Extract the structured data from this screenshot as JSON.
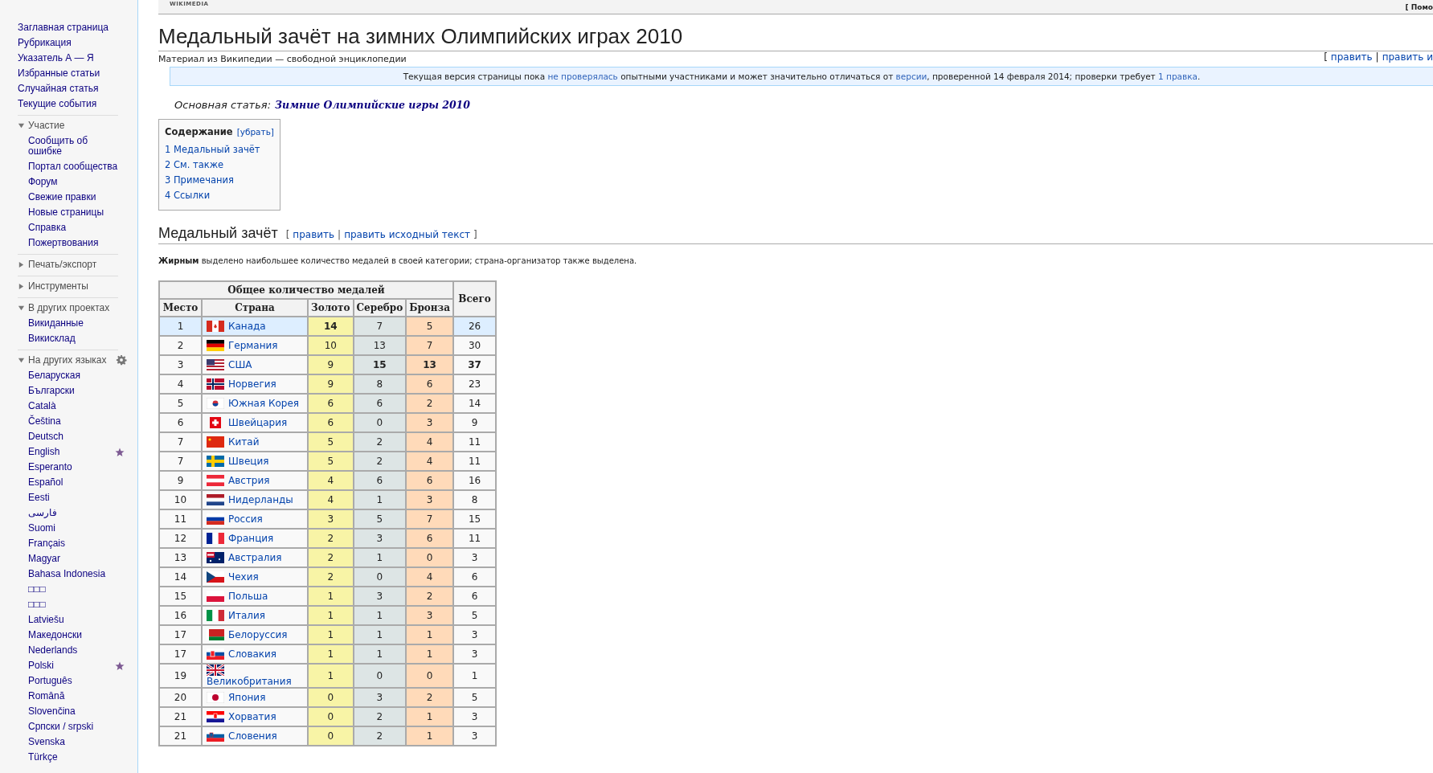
{
  "top_bar": {
    "logo": "WIKIMEDIA",
    "right_text": "[ Помо"
  },
  "sidebar": {
    "links": [
      "Заглавная страница",
      "Рубрикация",
      "Указатель А — Я",
      "Избранные статьи",
      "Случайная статья",
      "Текущие события"
    ],
    "sections": [
      {
        "kind": "links",
        "title": "Участие",
        "expanded": true,
        "items": [
          {
            "label": "Сообщить об ошибке",
            "starred": false
          },
          {
            "label": "Портал сообщества",
            "starred": false
          },
          {
            "label": "Форум",
            "starred": false
          },
          {
            "label": "Свежие правки",
            "starred": false
          },
          {
            "label": "Новые страницы",
            "starred": false
          },
          {
            "label": "Справка",
            "starred": false
          },
          {
            "label": "Пожертвования",
            "starred": false
          }
        ]
      },
      {
        "kind": "links",
        "title": "Печать/экспорт",
        "expanded": false
      },
      {
        "kind": "links",
        "title": "Инструменты",
        "expanded": false
      },
      {
        "kind": "links",
        "title": "В других проектах",
        "expanded": true,
        "items": [
          {
            "label": "Викиданные",
            "starred": false
          },
          {
            "label": "Викисклад",
            "starred": false
          }
        ]
      },
      {
        "kind": "languages",
        "title": "На других языках",
        "expanded": true,
        "items": [
          {
            "label": "Беларуская",
            "starred": false
          },
          {
            "label": "Български",
            "starred": false
          },
          {
            "label": "Català",
            "starred": false
          },
          {
            "label": "Čeština",
            "starred": false
          },
          {
            "label": "Deutsch",
            "starred": false
          },
          {
            "label": "English",
            "starred": true
          },
          {
            "label": "Esperanto",
            "starred": false
          },
          {
            "label": "Español",
            "starred": false
          },
          {
            "label": "Eesti",
            "starred": false
          },
          {
            "label": "فارسی",
            "starred": false
          },
          {
            "label": "Suomi",
            "starred": false
          },
          {
            "label": "Français",
            "starred": false
          },
          {
            "label": "Magyar",
            "starred": false
          },
          {
            "label": "Bahasa Indonesia",
            "starred": false
          },
          {
            "label": "□□□",
            "starred": false
          },
          {
            "label": "□□□",
            "starred": false
          },
          {
            "label": "Latviešu",
            "starred": false
          },
          {
            "label": "Македонски",
            "starred": false
          },
          {
            "label": "Nederlands",
            "starred": false
          },
          {
            "label": "Polski",
            "starred": true
          },
          {
            "label": "Português",
            "starred": false
          },
          {
            "label": "Română",
            "starred": false
          },
          {
            "label": "Slovenčina",
            "starred": false
          },
          {
            "label": "Српски / srpski",
            "starred": false
          },
          {
            "label": "Svenska",
            "starred": false
          },
          {
            "label": "Türkçe",
            "starred": false
          }
        ]
      }
    ]
  },
  "article": {
    "title": "Медальный зачёт на зимних Олимпийских играх 2010",
    "subtitle": "Материал из Википедии — свободной энциклопедии",
    "page_edit": {
      "open": "[",
      "links": [
        "править",
        "править и"
      ],
      "separator": "|"
    },
    "notice": [
      {
        "kind": "text",
        "text": "Текущая версия страницы пока "
      },
      {
        "kind": "link",
        "text": "не проверялась"
      },
      {
        "kind": "text",
        "text": " опытными участниками и может значительно отличаться от "
      },
      {
        "kind": "link",
        "text": "версии"
      },
      {
        "kind": "text",
        "text": ", проверенной 14 февраля 2014; проверки требует "
      },
      {
        "kind": "link",
        "text": "1 правка"
      },
      {
        "kind": "text",
        "text": "."
      }
    ],
    "main_article": {
      "label": "Основная статья:",
      "link": "Зимние Олимпийские игры 2010"
    },
    "toc": {
      "title": "Содержание",
      "toggle": "[убрать]",
      "items": [
        "1 Медальный зачёт",
        "2 См. также",
        "3 Примечания",
        "4 Ссылки"
      ]
    },
    "section": {
      "heading": "Медальный зачёт",
      "edit": {
        "open": "[",
        "links": [
          "править",
          "править исходный текст"
        ],
        "separator": "|",
        "close": "]"
      }
    },
    "legend": "**Жирным** выделено наибольшее количество медалей в своей категории; страна-организатор также выделена.",
    "table": {
      "group_header": "Общее количество медалей",
      "total_header": "Всего",
      "columns": [
        "Место",
        "Страна",
        "Золото",
        "Серебро",
        "Бронза"
      ],
      "rows": [
        {
          "place": "1",
          "country": "Канада",
          "host": true,
          "gold": {
            "value": "14",
            "bold": true
          },
          "silver": {
            "value": "7",
            "bold": false
          },
          "bronze": {
            "value": "5",
            "bold": false
          },
          "total": {
            "value": "26",
            "bold": false
          }
        },
        {
          "place": "2",
          "country": "Германия",
          "host": false,
          "gold": {
            "value": "10",
            "bold": false
          },
          "silver": {
            "value": "13",
            "bold": false
          },
          "bronze": {
            "value": "7",
            "bold": false
          },
          "total": {
            "value": "30",
            "bold": false
          }
        },
        {
          "place": "3",
          "country": "США",
          "host": false,
          "gold": {
            "value": "9",
            "bold": false
          },
          "silver": {
            "value": "15",
            "bold": true
          },
          "bronze": {
            "value": "13",
            "bold": true
          },
          "total": {
            "value": "37",
            "bold": true
          }
        },
        {
          "place": "4",
          "country": "Норвегия",
          "host": false,
          "gold": {
            "value": "9",
            "bold": false
          },
          "silver": {
            "value": "8",
            "bold": false
          },
          "bronze": {
            "value": "6",
            "bold": false
          },
          "total": {
            "value": "23",
            "bold": false
          }
        },
        {
          "place": "5",
          "country": "Южная Корея",
          "host": false,
          "gold": {
            "value": "6",
            "bold": false
          },
          "silver": {
            "value": "6",
            "bold": false
          },
          "bronze": {
            "value": "2",
            "bold": false
          },
          "total": {
            "value": "14",
            "bold": false
          }
        },
        {
          "place": "6",
          "country": "Швейцария",
          "host": false,
          "gold": {
            "value": "6",
            "bold": false
          },
          "silver": {
            "value": "0",
            "bold": false
          },
          "bronze": {
            "value": "3",
            "bold": false
          },
          "total": {
            "value": "9",
            "bold": false
          }
        },
        {
          "place": "7",
          "country": "Китай",
          "host": false,
          "gold": {
            "value": "5",
            "bold": false
          },
          "silver": {
            "value": "2",
            "bold": false
          },
          "bronze": {
            "value": "4",
            "bold": false
          },
          "total": {
            "value": "11",
            "bold": false
          }
        },
        {
          "place": "7",
          "country": "Швеция",
          "host": false,
          "gold": {
            "value": "5",
            "bold": false
          },
          "silver": {
            "value": "2",
            "bold": false
          },
          "bronze": {
            "value": "4",
            "bold": false
          },
          "total": {
            "value": "11",
            "bold": false
          }
        },
        {
          "place": "9",
          "country": "Австрия",
          "host": false,
          "gold": {
            "value": "4",
            "bold": false
          },
          "silver": {
            "value": "6",
            "bold": false
          },
          "bronze": {
            "value": "6",
            "bold": false
          },
          "total": {
            "value": "16",
            "bold": false
          }
        },
        {
          "place": "10",
          "country": "Нидерланды",
          "host": false,
          "gold": {
            "value": "4",
            "bold": false
          },
          "silver": {
            "value": "1",
            "bold": false
          },
          "bronze": {
            "value": "3",
            "bold": false
          },
          "total": {
            "value": "8",
            "bold": false
          }
        },
        {
          "place": "11",
          "country": "Россия",
          "host": false,
          "gold": {
            "value": "3",
            "bold": false
          },
          "silver": {
            "value": "5",
            "bold": false
          },
          "bronze": {
            "value": "7",
            "bold": false
          },
          "total": {
            "value": "15",
            "bold": false
          }
        },
        {
          "place": "12",
          "country": "Франция",
          "host": false,
          "gold": {
            "value": "2",
            "bold": false
          },
          "silver": {
            "value": "3",
            "bold": false
          },
          "bronze": {
            "value": "6",
            "bold": false
          },
          "total": {
            "value": "11",
            "bold": false
          }
        },
        {
          "place": "13",
          "country": "Австралия",
          "host": false,
          "gold": {
            "value": "2",
            "bold": false
          },
          "silver": {
            "value": "1",
            "bold": false
          },
          "bronze": {
            "value": "0",
            "bold": false
          },
          "total": {
            "value": "3",
            "bold": false
          }
        },
        {
          "place": "14",
          "country": "Чехия",
          "host": false,
          "gold": {
            "value": "2",
            "bold": false
          },
          "silver": {
            "value": "0",
            "bold": false
          },
          "bronze": {
            "value": "4",
            "bold": false
          },
          "total": {
            "value": "6",
            "bold": false
          }
        },
        {
          "place": "15",
          "country": "Польша",
          "host": false,
          "gold": {
            "value": "1",
            "bold": false
          },
          "silver": {
            "value": "3",
            "bold": false
          },
          "bronze": {
            "value": "2",
            "bold": false
          },
          "total": {
            "value": "6",
            "bold": false
          }
        },
        {
          "place": "16",
          "country": "Италия",
          "host": false,
          "gold": {
            "value": "1",
            "bold": false
          },
          "silver": {
            "value": "1",
            "bold": false
          },
          "bronze": {
            "value": "3",
            "bold": false
          },
          "total": {
            "value": "5",
            "bold": false
          }
        },
        {
          "place": "17",
          "country": "Белоруссия",
          "host": false,
          "gold": {
            "value": "1",
            "bold": false
          },
          "silver": {
            "value": "1",
            "bold": false
          },
          "bronze": {
            "value": "1",
            "bold": false
          },
          "total": {
            "value": "3",
            "bold": false
          }
        },
        {
          "place": "17",
          "country": "Словакия",
          "host": false,
          "gold": {
            "value": "1",
            "bold": false
          },
          "silver": {
            "value": "1",
            "bold": false
          },
          "bronze": {
            "value": "1",
            "bold": false
          },
          "total": {
            "value": "3",
            "bold": false
          }
        },
        {
          "place": "19",
          "country": "Великобритания",
          "host": false,
          "gold": {
            "value": "1",
            "bold": false
          },
          "silver": {
            "value": "0",
            "bold": false
          },
          "bronze": {
            "value": "0",
            "bold": false
          },
          "total": {
            "value": "1",
            "bold": false
          }
        },
        {
          "place": "20",
          "country": "Япония",
          "host": false,
          "gold": {
            "value": "0",
            "bold": false
          },
          "silver": {
            "value": "3",
            "bold": false
          },
          "bronze": {
            "value": "2",
            "bold": false
          },
          "total": {
            "value": "5",
            "bold": false
          }
        },
        {
          "place": "21",
          "country": "Хорватия",
          "host": false,
          "gold": {
            "value": "0",
            "bold": false
          },
          "silver": {
            "value": "2",
            "bold": false
          },
          "bronze": {
            "value": "1",
            "bold": false
          },
          "total": {
            "value": "3",
            "bold": false
          }
        },
        {
          "place": "21",
          "country": "Словения",
          "host": false,
          "gold": {
            "value": "0",
            "bold": false
          },
          "silver": {
            "value": "2",
            "bold": false
          },
          "bronze": {
            "value": "1",
            "bold": false
          },
          "total": {
            "value": "3",
            "bold": false
          }
        }
      ]
    }
  }
}
